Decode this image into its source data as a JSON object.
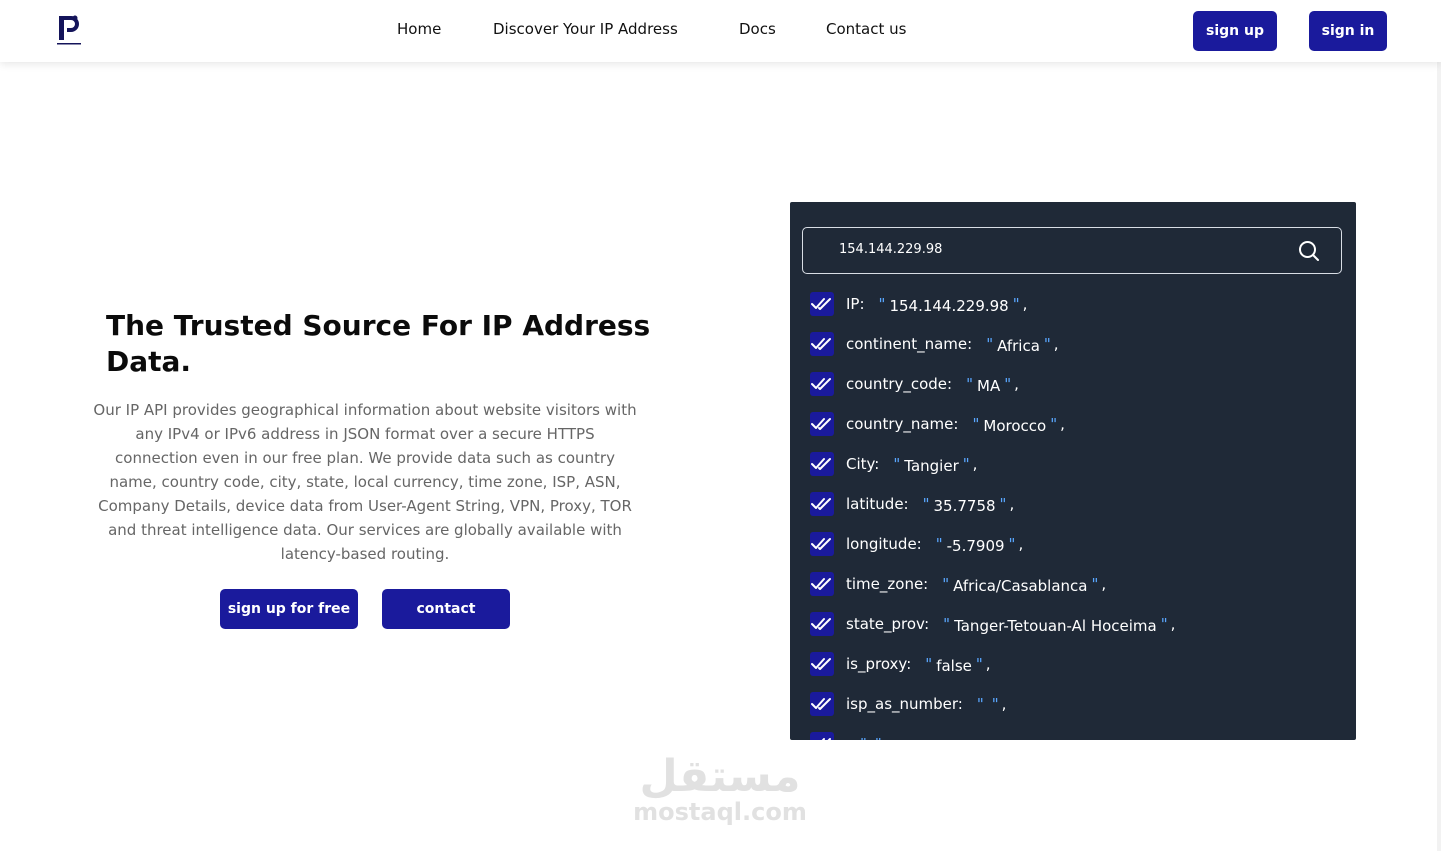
{
  "header": {
    "nav": [
      {
        "label": "Home"
      },
      {
        "label": "Discover Your IP Address"
      },
      {
        "label": "Docs"
      },
      {
        "label": "Contact us"
      }
    ],
    "signup_label": "sign up",
    "signin_label": "sign in",
    "logo_icon": "brand-logo"
  },
  "hero": {
    "title": "The Trusted Source For IP Address Data.",
    "description": "Our IP API provides geographical information about website visitors with any IPv4 or IPv6 address in JSON format over a secure HTTPS connection even in our free plan. We provide data such as country name, country code, city, state, local currency, time zone, ISP, ASN, Company Details, device data from User-Agent String, VPN, Proxy, TOR and threat intelligence data. Our services are globally available with latency-based routing.",
    "primary_button": "sign up for free",
    "secondary_button": "contact"
  },
  "lookup": {
    "query": "154.144.229.98",
    "search_icon": "search-icon",
    "fields": [
      {
        "key": "IP:",
        "value": "154.144.229.98"
      },
      {
        "key": "continent_name:",
        "value": "Africa"
      },
      {
        "key": "country_code:",
        "value": "MA"
      },
      {
        "key": "country_name:",
        "value": "Morocco"
      },
      {
        "key": "City:",
        "value": "Tangier"
      },
      {
        "key": "latitude:",
        "value": "35.7758"
      },
      {
        "key": "longitude:",
        "value": "-5.7909"
      },
      {
        "key": "time_zone:",
        "value": "Africa/Casablanca"
      },
      {
        "key": "state_prov:",
        "value": "Tanger-Tetouan-Al Hoceima"
      },
      {
        "key": "is_proxy:",
        "value": "false"
      },
      {
        "key": "isp_as_number:",
        "value": ""
      },
      {
        "key": "",
        "value": ""
      }
    ]
  },
  "watermark": {
    "arabic": "مستقل",
    "latin": "mostaql.com"
  },
  "colors": {
    "brand": "#1a1a9c",
    "panel": "#1f2937",
    "quote": "#5aa7ff"
  }
}
